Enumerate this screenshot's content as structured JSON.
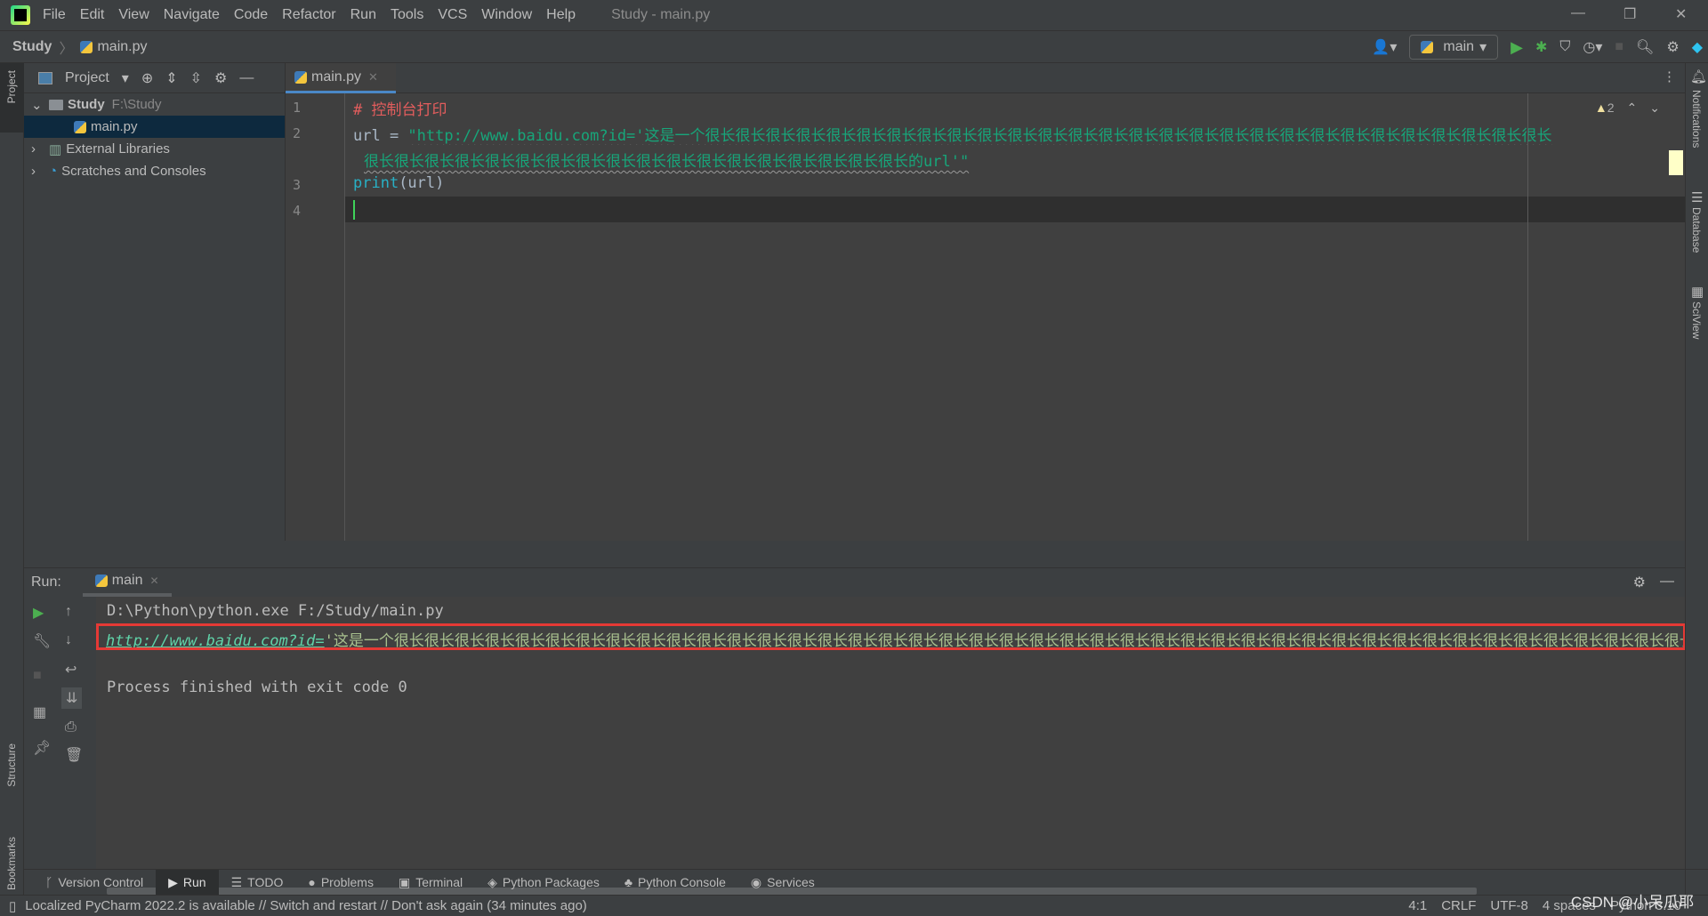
{
  "window": {
    "title": "Study - main.py",
    "menu": [
      "File",
      "Edit",
      "View",
      "Navigate",
      "Code",
      "Refactor",
      "Run",
      "Tools",
      "VCS",
      "Window",
      "Help"
    ]
  },
  "navbar": {
    "project": "Study",
    "file": "main.py",
    "run_config": "main"
  },
  "sidebar_left": {
    "project": "Project",
    "structure": "Structure",
    "bookmarks": "Bookmarks"
  },
  "sidebar_right": {
    "notifications": "Notifications",
    "database": "Database",
    "sciview": "SciView"
  },
  "project_panel": {
    "title": "Project",
    "tree": [
      {
        "label": "Study",
        "path": "F:\\Study"
      },
      {
        "label": "main.py"
      },
      {
        "label": "External Libraries"
      },
      {
        "label": "Scratches and Consoles"
      }
    ]
  },
  "editor": {
    "tab": "main.py",
    "warnings": "2",
    "lines": [
      {
        "num": "1",
        "text": "# 控制台打印"
      },
      {
        "num": "2",
        "prefix": "url = ",
        "str1": "\"http://www.baidu.com?id='这是一个很长很长很长很长很长很长很长很长很长很长很长很长很长很长很长很长很长很长很长很长很长很长很长很长很长很长很长很长",
        "str2": "很长很长很长很长很长很长很长很长很长很长很长很长很长很长很长很长很长很长的url'\""
      },
      {
        "num": "3",
        "fn": "print",
        "args": "(url)"
      },
      {
        "num": "4",
        "text": ""
      }
    ]
  },
  "run": {
    "label": "Run:",
    "tab": "main",
    "cmd": "D:\\Python\\python.exe F:/Study/main.py",
    "link": "http://www.baidu.com?id=",
    "output_rest": "'这是一个很长很长很长很长很长很长很长很长很长很长很长很长很长很长很长很长很长很长很长很长很长很长很长很长很长很长很长很长很长很长很长很长很长很长很长很长很长很长很长很长很长很长很长很长很长的url'",
    "exit": "Process finished with exit code 0"
  },
  "bottom_tabs": [
    "Version Control",
    "Run",
    "TODO",
    "Problems",
    "Terminal",
    "Python Packages",
    "Python Console",
    "Services"
  ],
  "status": {
    "message": "Localized PyCharm 2022.2 is available // Switch and restart // Don't ask again (34 minutes ago)",
    "position": "4:1",
    "line_sep": "CRLF",
    "encoding": "UTF-8",
    "indent": "4 spaces",
    "interpreter": "Python 3.10"
  },
  "watermark": "CSDN @小呆瓜耶",
  "colors": {
    "string": "#17a67a",
    "comment": "#e35d5d",
    "highlight_box": "#e53935",
    "run_green": "#4caf50"
  }
}
